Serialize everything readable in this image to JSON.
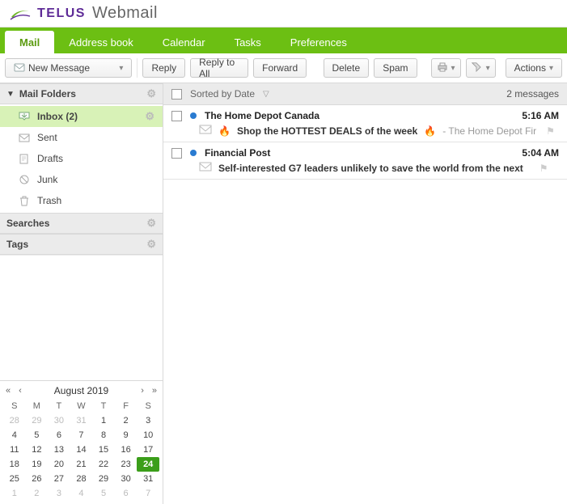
{
  "brand": {
    "name": "TELUS",
    "product": "Webmail"
  },
  "nav": {
    "tabs": [
      {
        "label": "Mail",
        "active": true
      },
      {
        "label": "Address book"
      },
      {
        "label": "Calendar"
      },
      {
        "label": "Tasks"
      },
      {
        "label": "Preferences"
      }
    ]
  },
  "toolbar": {
    "new_message": "New Message",
    "reply": "Reply",
    "reply_all": "Reply to All",
    "forward": "Forward",
    "delete": "Delete",
    "spam": "Spam",
    "actions": "Actions"
  },
  "sidebar": {
    "folders_header": "Mail Folders",
    "folders": [
      {
        "label": "Inbox (2)",
        "icon": "inbox-icon",
        "active": true
      },
      {
        "label": "Sent",
        "icon": "sent-icon"
      },
      {
        "label": "Drafts",
        "icon": "drafts-icon"
      },
      {
        "label": "Junk",
        "icon": "junk-icon"
      },
      {
        "label": "Trash",
        "icon": "trash-icon"
      }
    ],
    "searches_header": "Searches",
    "tags_header": "Tags"
  },
  "calendar": {
    "title": "August 2019",
    "dow": [
      "S",
      "M",
      "T",
      "W",
      "T",
      "F",
      "S"
    ],
    "weeks": [
      [
        {
          "d": "28",
          "dim": true
        },
        {
          "d": "29",
          "dim": true
        },
        {
          "d": "30",
          "dim": true
        },
        {
          "d": "31",
          "dim": true
        },
        {
          "d": "1"
        },
        {
          "d": "2"
        },
        {
          "d": "3"
        }
      ],
      [
        {
          "d": "4"
        },
        {
          "d": "5"
        },
        {
          "d": "6"
        },
        {
          "d": "7"
        },
        {
          "d": "8"
        },
        {
          "d": "9"
        },
        {
          "d": "10"
        }
      ],
      [
        {
          "d": "11"
        },
        {
          "d": "12"
        },
        {
          "d": "13"
        },
        {
          "d": "14"
        },
        {
          "d": "15"
        },
        {
          "d": "16"
        },
        {
          "d": "17"
        }
      ],
      [
        {
          "d": "18"
        },
        {
          "d": "19"
        },
        {
          "d": "20"
        },
        {
          "d": "21"
        },
        {
          "d": "22"
        },
        {
          "d": "23"
        },
        {
          "d": "24",
          "today": true
        }
      ],
      [
        {
          "d": "25"
        },
        {
          "d": "26"
        },
        {
          "d": "27"
        },
        {
          "d": "28"
        },
        {
          "d": "29"
        },
        {
          "d": "30"
        },
        {
          "d": "31"
        }
      ],
      [
        {
          "d": "1",
          "dim": true
        },
        {
          "d": "2",
          "dim": true
        },
        {
          "d": "3",
          "dim": true
        },
        {
          "d": "4",
          "dim": true
        },
        {
          "d": "5",
          "dim": true
        },
        {
          "d": "6",
          "dim": true
        },
        {
          "d": "7",
          "dim": true
        }
      ]
    ]
  },
  "list": {
    "sort_label": "Sorted by Date",
    "count_label": "2 messages",
    "messages": [
      {
        "from": "The Home Depot Canada",
        "time": "5:16 AM",
        "emoji": "🔥",
        "subject": "Shop the HOTTEST DEALS of the week",
        "emoji2": "🔥",
        "snippet": " - The Home Depot Fir"
      },
      {
        "from": "Financial Post",
        "time": "5:04 AM",
        "subject": "Self-interested G7 leaders unlikely to save the world from the next",
        "snippet": ""
      }
    ]
  }
}
